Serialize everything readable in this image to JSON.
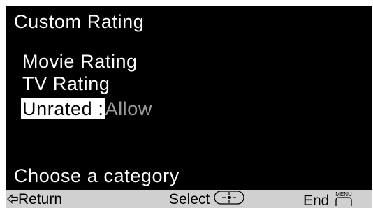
{
  "screen": {
    "title": "Custom Rating",
    "menu": {
      "items": [
        {
          "label": "Movie Rating"
        },
        {
          "label": "TV Rating"
        }
      ],
      "selected": {
        "label": "Unrated :",
        "value": "Allow"
      }
    },
    "hint": "Choose a category"
  },
  "footer": {
    "return_label": "Return",
    "select_label": "Select",
    "end_label": "End",
    "menu_key_label": "MENU"
  },
  "icons": {
    "return": "left-arrow-icon",
    "select": "joystick-center-icon",
    "end": "menu-button-icon"
  },
  "colors": {
    "background": "#000000",
    "text": "#ffffff",
    "highlight": "#ffffff",
    "value_dim": "#9a9a9a",
    "footer_bg": "#d0d0d0"
  }
}
